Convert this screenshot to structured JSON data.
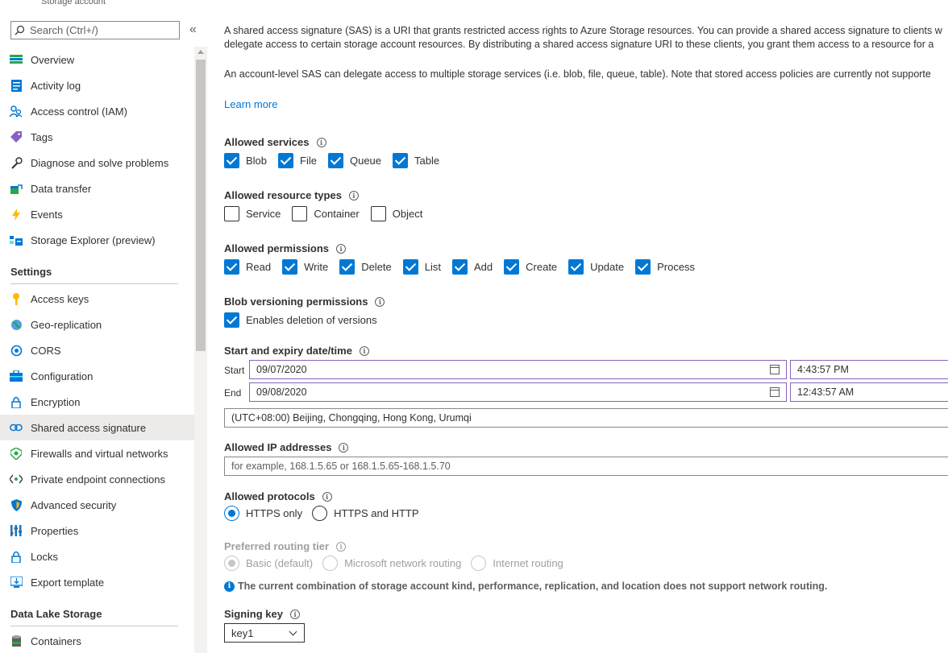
{
  "sidebar": {
    "resource_type": "Storage account",
    "search_placeholder": "Search (Ctrl+/)",
    "collapse_glyph": "«",
    "items_top": [
      {
        "label": "Overview",
        "icon": "overview-icon"
      },
      {
        "label": "Activity log",
        "icon": "activity-log-icon"
      },
      {
        "label": "Access control (IAM)",
        "icon": "access-control-icon"
      },
      {
        "label": "Tags",
        "icon": "tag-icon"
      },
      {
        "label": "Diagnose and solve problems",
        "icon": "wrench-icon"
      },
      {
        "label": "Data transfer",
        "icon": "data-transfer-icon"
      },
      {
        "label": "Events",
        "icon": "lightning-icon"
      },
      {
        "label": "Storage Explorer (preview)",
        "icon": "storage-explorer-icon"
      }
    ],
    "settings_heading": "Settings",
    "items_settings": [
      {
        "label": "Access keys",
        "icon": "key-icon"
      },
      {
        "label": "Geo-replication",
        "icon": "globe-icon"
      },
      {
        "label": "CORS",
        "icon": "cors-icon"
      },
      {
        "label": "Configuration",
        "icon": "configuration-icon"
      },
      {
        "label": "Encryption",
        "icon": "lock-icon"
      },
      {
        "label": "Shared access signature",
        "icon": "link-icon",
        "active": true
      },
      {
        "label": "Firewalls and virtual networks",
        "icon": "firewall-icon"
      },
      {
        "label": "Private endpoint connections",
        "icon": "private-endpoint-icon"
      },
      {
        "label": "Advanced security",
        "icon": "shield-icon"
      },
      {
        "label": "Properties",
        "icon": "properties-icon"
      },
      {
        "label": "Locks",
        "icon": "lock-icon"
      },
      {
        "label": "Export template",
        "icon": "export-template-icon"
      }
    ],
    "datalake_heading": "Data Lake Storage",
    "items_datalake": [
      {
        "label": "Containers",
        "icon": "containers-icon"
      }
    ]
  },
  "main": {
    "intro_line1": "A shared access signature (SAS) is a URI that grants restricted access rights to Azure Storage resources. You can provide a shared access signature to clients w",
    "intro_line2": "delegate access to certain storage account resources. By distributing a shared access signature URI to these clients, you grant them access to a resource for a",
    "intro_line3": "An account-level SAS can delegate access to multiple storage services (i.e. blob, file, queue, table). Note that stored access policies are currently not supporte",
    "learn_more": "Learn more",
    "allowed_services": {
      "label": "Allowed services",
      "options": [
        {
          "label": "Blob",
          "checked": true
        },
        {
          "label": "File",
          "checked": true
        },
        {
          "label": "Queue",
          "checked": true
        },
        {
          "label": "Table",
          "checked": true
        }
      ]
    },
    "allowed_resource_types": {
      "label": "Allowed resource types",
      "options": [
        {
          "label": "Service",
          "checked": false
        },
        {
          "label": "Container",
          "checked": false
        },
        {
          "label": "Object",
          "checked": false
        }
      ]
    },
    "allowed_permissions": {
      "label": "Allowed permissions",
      "options": [
        {
          "label": "Read",
          "checked": true
        },
        {
          "label": "Write",
          "checked": true
        },
        {
          "label": "Delete",
          "checked": true
        },
        {
          "label": "List",
          "checked": true
        },
        {
          "label": "Add",
          "checked": true
        },
        {
          "label": "Create",
          "checked": true
        },
        {
          "label": "Update",
          "checked": true
        },
        {
          "label": "Process",
          "checked": true
        }
      ]
    },
    "blob_versioning": {
      "label": "Blob versioning permissions",
      "option": "Enables deletion of versions",
      "checked": true
    },
    "dates": {
      "label": "Start and expiry date/time",
      "start_label": "Start",
      "start_date": "09/07/2020",
      "start_time": "4:43:57 PM",
      "end_label": "End",
      "end_date": "09/08/2020",
      "end_time": "12:43:57 AM",
      "timezone": "(UTC+08:00) Beijing, Chongqing, Hong Kong, Urumqi"
    },
    "allowed_ip": {
      "label": "Allowed IP addresses",
      "placeholder": "for example, 168.1.5.65 or 168.1.5.65-168.1.5.70"
    },
    "protocols": {
      "label": "Allowed protocols",
      "options": [
        {
          "label": "HTTPS only",
          "checked": true
        },
        {
          "label": "HTTPS and HTTP",
          "checked": false
        }
      ]
    },
    "routing": {
      "label": "Preferred routing tier",
      "options": [
        {
          "label": "Basic (default)",
          "checked": true
        },
        {
          "label": "Microsoft network routing",
          "checked": false
        },
        {
          "label": "Internet routing",
          "checked": false
        }
      ],
      "notice": "The current combination of storage account kind, performance, replication, and location does not support network routing."
    },
    "signing_key": {
      "label": "Signing key",
      "value": "key1"
    }
  },
  "colors": {
    "accent": "#0078d4",
    "focus_border": "#8764b8",
    "active_nav": "#edebe9"
  }
}
